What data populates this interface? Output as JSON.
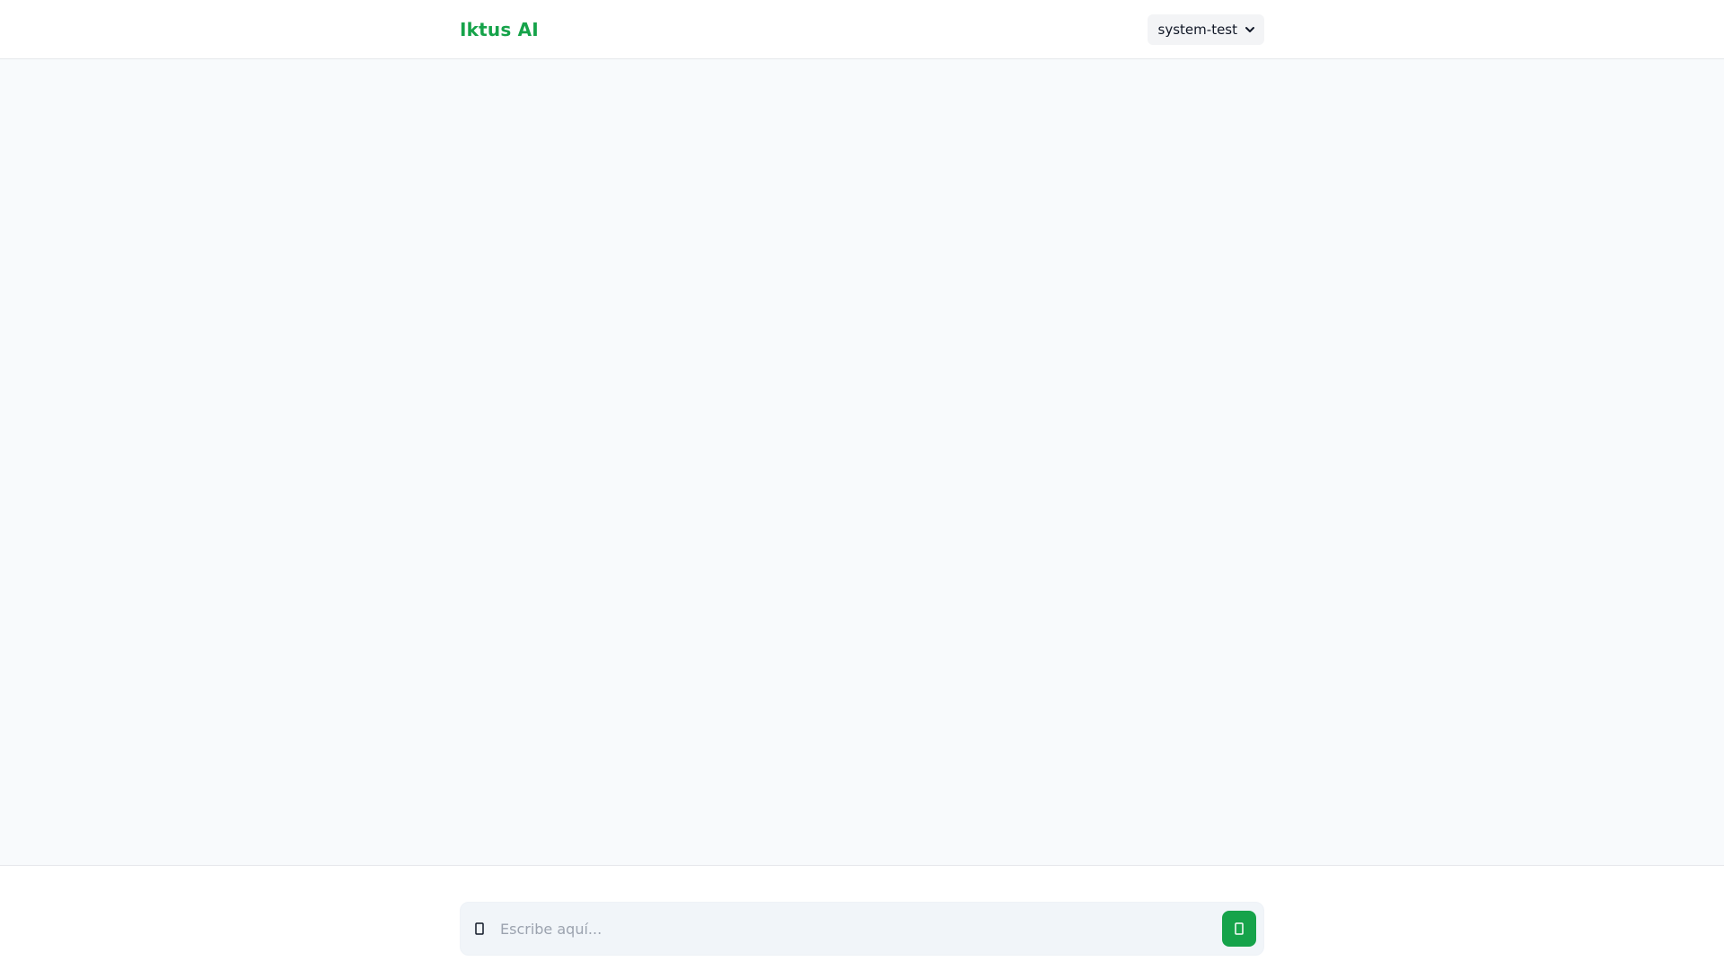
{
  "app": {
    "title": "Iktus AI"
  },
  "header": {
    "selector": {
      "selected": "system-test",
      "options": [
        "system-test"
      ]
    }
  },
  "composer": {
    "placeholder": "Escribe aquí...",
    "value": ""
  },
  "icons": {
    "attach": "paperclip-icon",
    "send": "send-icon",
    "dropdown": "chevron-down-icon"
  },
  "colors": {
    "brand": "#16a34a",
    "background": "#f8fafc",
    "input_bg": "#f1f5f9"
  }
}
